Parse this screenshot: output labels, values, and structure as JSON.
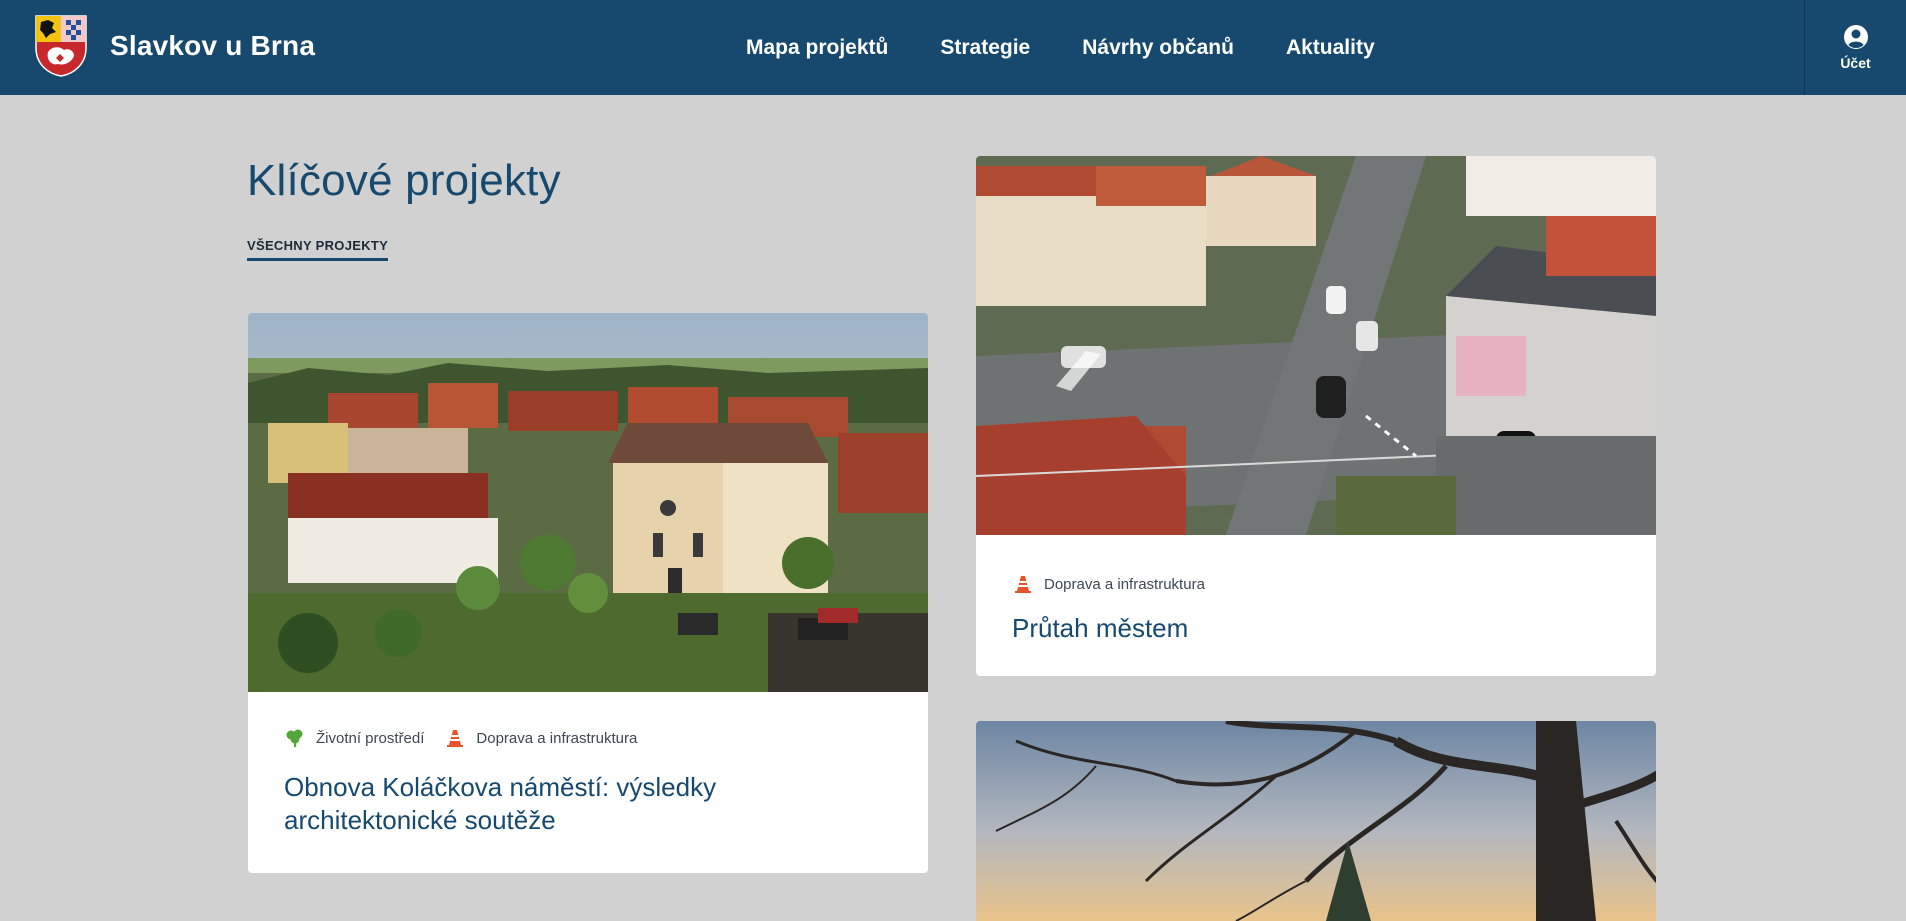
{
  "header": {
    "brand_name": "Slavkov u Brna",
    "crest_icon": "municipal-coat-of-arms",
    "nav": [
      {
        "label": "Mapa projektů"
      },
      {
        "label": "Strategie"
      },
      {
        "label": "Návrhy občanů"
      },
      {
        "label": "Aktuality"
      }
    ],
    "account_label": "Účet",
    "account_icon": "user-circle-icon"
  },
  "main": {
    "section_title": "Klíčové projekty",
    "all_projects_label": "VŠECHNY PROJEKTY",
    "cards": [
      {
        "image": "aerial-town-square-synagogue-photo",
        "tags": [
          {
            "icon": "tree-icon",
            "label": "Životní prostředí",
            "color": "#55a63a"
          },
          {
            "icon": "traffic-cone-icon",
            "label": "Doprava a infrastruktura",
            "color": "#e8552a"
          }
        ],
        "title": "Obnova Koláčkova náměstí: výsledky architektonické soutěže"
      },
      {
        "image": "aerial-road-intersection-photo",
        "tags": [
          {
            "icon": "traffic-cone-icon",
            "label": "Doprava a infrastruktura",
            "color": "#e8552a"
          }
        ],
        "title": "Průtah městem"
      },
      {
        "image": "tree-branches-sunset-photo",
        "tags": [],
        "title": ""
      }
    ]
  },
  "colors": {
    "header_bg": "#17496f",
    "page_bg": "#d1d1d1",
    "title": "#17496f"
  }
}
